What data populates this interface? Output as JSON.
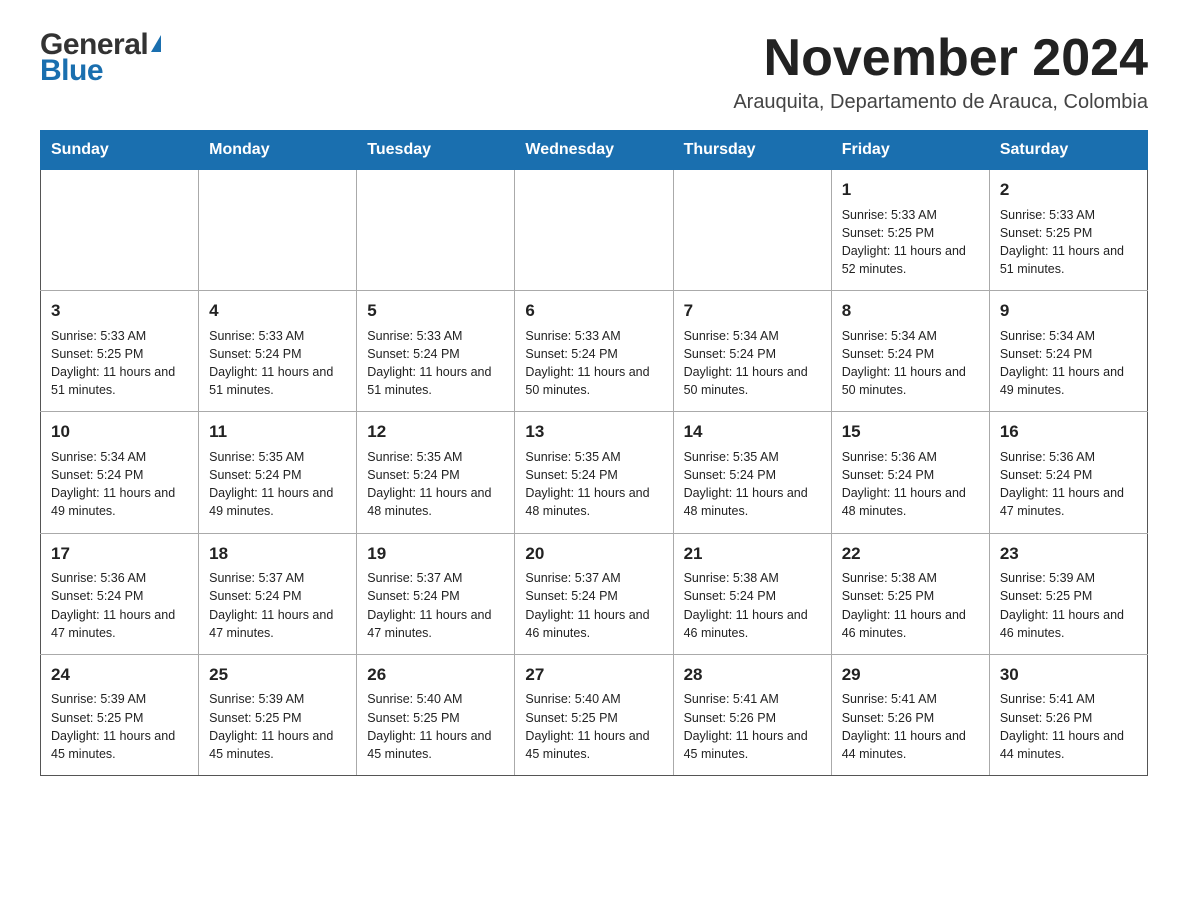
{
  "logo": {
    "general": "General",
    "blue": "Blue"
  },
  "header": {
    "title": "November 2024",
    "subtitle": "Arauquita, Departamento de Arauca, Colombia"
  },
  "weekdays": [
    "Sunday",
    "Monday",
    "Tuesday",
    "Wednesday",
    "Thursday",
    "Friday",
    "Saturday"
  ],
  "rows": [
    [
      {
        "day": "",
        "info": ""
      },
      {
        "day": "",
        "info": ""
      },
      {
        "day": "",
        "info": ""
      },
      {
        "day": "",
        "info": ""
      },
      {
        "day": "",
        "info": ""
      },
      {
        "day": "1",
        "info": "Sunrise: 5:33 AM\nSunset: 5:25 PM\nDaylight: 11 hours and 52 minutes."
      },
      {
        "day": "2",
        "info": "Sunrise: 5:33 AM\nSunset: 5:25 PM\nDaylight: 11 hours and 51 minutes."
      }
    ],
    [
      {
        "day": "3",
        "info": "Sunrise: 5:33 AM\nSunset: 5:25 PM\nDaylight: 11 hours and 51 minutes."
      },
      {
        "day": "4",
        "info": "Sunrise: 5:33 AM\nSunset: 5:24 PM\nDaylight: 11 hours and 51 minutes."
      },
      {
        "day": "5",
        "info": "Sunrise: 5:33 AM\nSunset: 5:24 PM\nDaylight: 11 hours and 51 minutes."
      },
      {
        "day": "6",
        "info": "Sunrise: 5:33 AM\nSunset: 5:24 PM\nDaylight: 11 hours and 50 minutes."
      },
      {
        "day": "7",
        "info": "Sunrise: 5:34 AM\nSunset: 5:24 PM\nDaylight: 11 hours and 50 minutes."
      },
      {
        "day": "8",
        "info": "Sunrise: 5:34 AM\nSunset: 5:24 PM\nDaylight: 11 hours and 50 minutes."
      },
      {
        "day": "9",
        "info": "Sunrise: 5:34 AM\nSunset: 5:24 PM\nDaylight: 11 hours and 49 minutes."
      }
    ],
    [
      {
        "day": "10",
        "info": "Sunrise: 5:34 AM\nSunset: 5:24 PM\nDaylight: 11 hours and 49 minutes."
      },
      {
        "day": "11",
        "info": "Sunrise: 5:35 AM\nSunset: 5:24 PM\nDaylight: 11 hours and 49 minutes."
      },
      {
        "day": "12",
        "info": "Sunrise: 5:35 AM\nSunset: 5:24 PM\nDaylight: 11 hours and 48 minutes."
      },
      {
        "day": "13",
        "info": "Sunrise: 5:35 AM\nSunset: 5:24 PM\nDaylight: 11 hours and 48 minutes."
      },
      {
        "day": "14",
        "info": "Sunrise: 5:35 AM\nSunset: 5:24 PM\nDaylight: 11 hours and 48 minutes."
      },
      {
        "day": "15",
        "info": "Sunrise: 5:36 AM\nSunset: 5:24 PM\nDaylight: 11 hours and 48 minutes."
      },
      {
        "day": "16",
        "info": "Sunrise: 5:36 AM\nSunset: 5:24 PM\nDaylight: 11 hours and 47 minutes."
      }
    ],
    [
      {
        "day": "17",
        "info": "Sunrise: 5:36 AM\nSunset: 5:24 PM\nDaylight: 11 hours and 47 minutes."
      },
      {
        "day": "18",
        "info": "Sunrise: 5:37 AM\nSunset: 5:24 PM\nDaylight: 11 hours and 47 minutes."
      },
      {
        "day": "19",
        "info": "Sunrise: 5:37 AM\nSunset: 5:24 PM\nDaylight: 11 hours and 47 minutes."
      },
      {
        "day": "20",
        "info": "Sunrise: 5:37 AM\nSunset: 5:24 PM\nDaylight: 11 hours and 46 minutes."
      },
      {
        "day": "21",
        "info": "Sunrise: 5:38 AM\nSunset: 5:24 PM\nDaylight: 11 hours and 46 minutes."
      },
      {
        "day": "22",
        "info": "Sunrise: 5:38 AM\nSunset: 5:25 PM\nDaylight: 11 hours and 46 minutes."
      },
      {
        "day": "23",
        "info": "Sunrise: 5:39 AM\nSunset: 5:25 PM\nDaylight: 11 hours and 46 minutes."
      }
    ],
    [
      {
        "day": "24",
        "info": "Sunrise: 5:39 AM\nSunset: 5:25 PM\nDaylight: 11 hours and 45 minutes."
      },
      {
        "day": "25",
        "info": "Sunrise: 5:39 AM\nSunset: 5:25 PM\nDaylight: 11 hours and 45 minutes."
      },
      {
        "day": "26",
        "info": "Sunrise: 5:40 AM\nSunset: 5:25 PM\nDaylight: 11 hours and 45 minutes."
      },
      {
        "day": "27",
        "info": "Sunrise: 5:40 AM\nSunset: 5:25 PM\nDaylight: 11 hours and 45 minutes."
      },
      {
        "day": "28",
        "info": "Sunrise: 5:41 AM\nSunset: 5:26 PM\nDaylight: 11 hours and 45 minutes."
      },
      {
        "day": "29",
        "info": "Sunrise: 5:41 AM\nSunset: 5:26 PM\nDaylight: 11 hours and 44 minutes."
      },
      {
        "day": "30",
        "info": "Sunrise: 5:41 AM\nSunset: 5:26 PM\nDaylight: 11 hours and 44 minutes."
      }
    ]
  ]
}
